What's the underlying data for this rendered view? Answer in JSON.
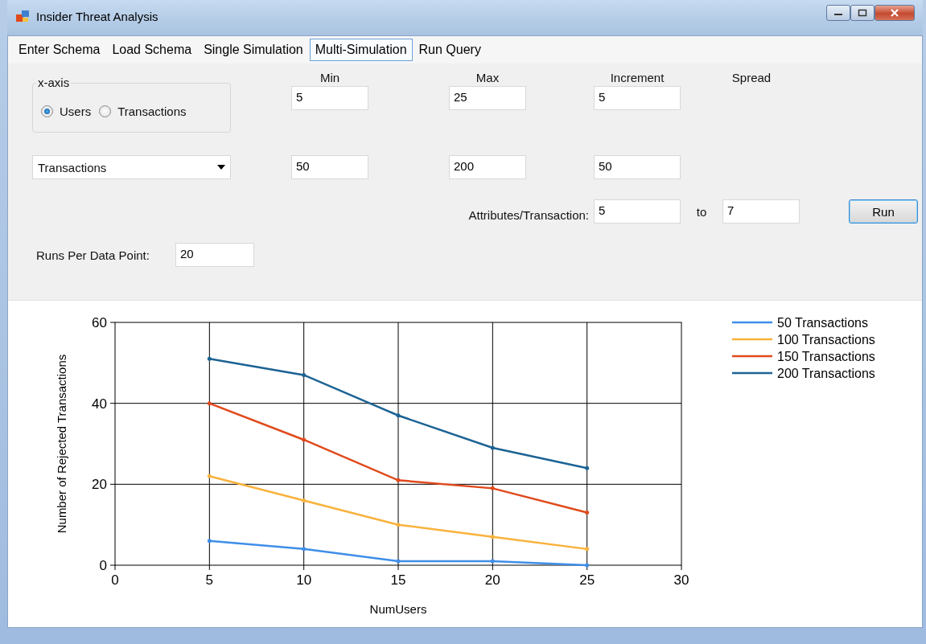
{
  "window": {
    "title": "Insider Threat Analysis"
  },
  "menu": [
    {
      "label": "Enter Schema",
      "selected": false
    },
    {
      "label": "Load Schema",
      "selected": false
    },
    {
      "label": "Single Simulation",
      "selected": false
    },
    {
      "label": "Multi-Simulation",
      "selected": true
    },
    {
      "label": "Run Query",
      "selected": false
    }
  ],
  "x_axis_group": {
    "label": "x-axis",
    "options": [
      {
        "label": "Users",
        "selected": true
      },
      {
        "label": "Transactions",
        "selected": false
      }
    ]
  },
  "headers": [
    "Min",
    "Max",
    "Increment",
    "Spread"
  ],
  "row_1": {
    "min": "5",
    "max": "25",
    "increment": "5"
  },
  "series_dropdown": {
    "value": "Transactions"
  },
  "row_2": {
    "min": "50",
    "max": "200",
    "increment": "50"
  },
  "attributes": {
    "label": "Attributes/Transaction:",
    "from": "5",
    "to_label": "to",
    "to": "7"
  },
  "run_button": "Run",
  "runs": {
    "label": "Runs Per Data Point:",
    "value": "20"
  },
  "chart_data": {
    "type": "line",
    "xlabel": "NumUsers",
    "ylabel": "Number of Rejected Transactions",
    "x": [
      5,
      10,
      15,
      20,
      25
    ],
    "xlim": [
      0,
      30
    ],
    "ylim": [
      0,
      60
    ],
    "grid": true,
    "legend": true,
    "xticks": [
      {
        "value": 0,
        "label": "0"
      },
      {
        "value": 5,
        "label": "5"
      },
      {
        "value": 10,
        "label": "10"
      },
      {
        "value": 15,
        "label": "15"
      },
      {
        "value": 20,
        "label": "20"
      },
      {
        "value": 25,
        "label": "25"
      },
      {
        "value": 30,
        "label": "30"
      }
    ],
    "yticks": [
      {
        "value": 0,
        "label": "0"
      },
      {
        "value": 20,
        "label": "20"
      },
      {
        "value": 40,
        "label": "40"
      },
      {
        "value": 60,
        "label": "60"
      }
    ],
    "series": [
      {
        "name": "50 Transactions",
        "color": "#3f8ee8",
        "values": [
          6,
          4,
          1,
          1,
          0
        ]
      },
      {
        "name": "100 Transactions",
        "color": "#f9b23c",
        "values": [
          22,
          16,
          10,
          7,
          4
        ]
      },
      {
        "name": "150 Transactions",
        "color": "#e04a1c",
        "values": [
          40,
          31,
          21,
          19,
          13
        ]
      },
      {
        "name": "200 Transactions",
        "color": "#1c6394",
        "values": [
          51,
          47,
          37,
          29,
          24
        ]
      }
    ]
  }
}
